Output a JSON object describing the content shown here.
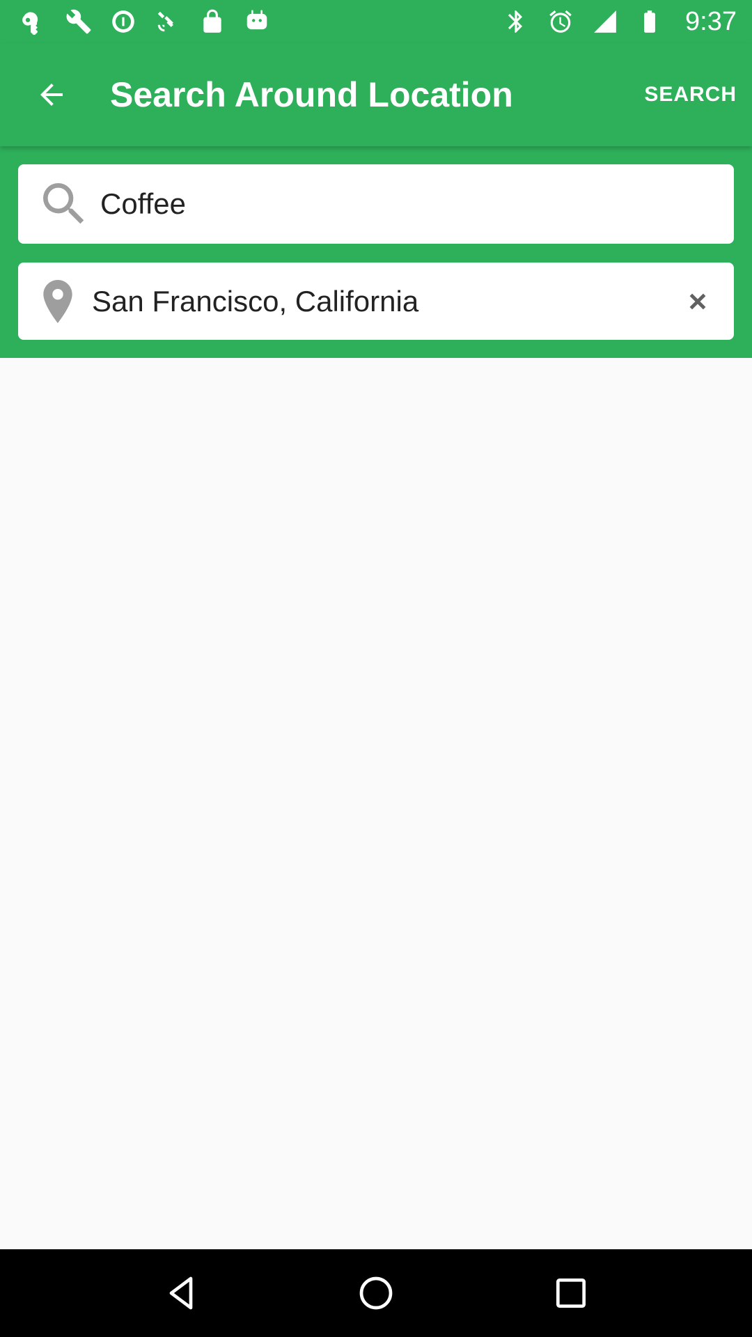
{
  "status_bar": {
    "time": "9:37",
    "left_icons": [
      "key-icon",
      "wrench-icon",
      "data-saver-icon",
      "satellite-icon",
      "lock-icon",
      "android-icon"
    ],
    "right_icons": [
      "bluetooth-icon",
      "alarm-icon",
      "signal-icon",
      "battery-icon"
    ]
  },
  "app_bar": {
    "title": "Search Around Location",
    "action_label": "SEARCH",
    "back_icon": "arrow-back-icon"
  },
  "search": {
    "query_value": "Coffee",
    "location_value": "San Francisco, California",
    "query_icon": "search-icon",
    "location_icon": "location-pin-icon",
    "clear_icon": "close-icon"
  },
  "nav_bar": {
    "buttons": [
      "back-triangle-icon",
      "home-circle-icon",
      "recents-square-icon"
    ]
  },
  "colors": {
    "primary": "#2eb05a",
    "background": "#fafafa",
    "nav_background": "#000000",
    "icon_gray": "#9e9e9e"
  }
}
